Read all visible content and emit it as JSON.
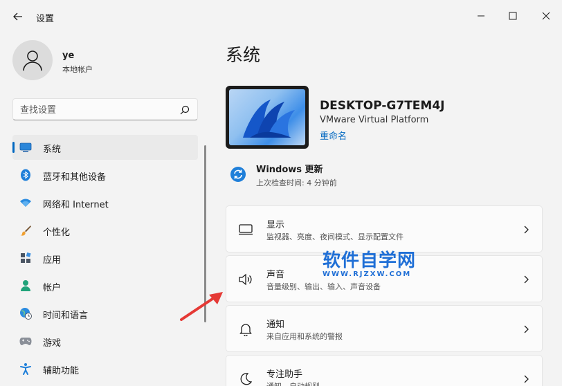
{
  "window": {
    "title": "设置",
    "accent": "#0067c0",
    "annotation_color": "#e53935"
  },
  "user": {
    "name": "ye",
    "account_type": "本地帐户"
  },
  "search": {
    "placeholder": "查找设置"
  },
  "sidebar": {
    "items": [
      {
        "label": "系统",
        "icon": "monitor-icon",
        "active": true
      },
      {
        "label": "蓝牙和其他设备",
        "icon": "bluetooth-icon"
      },
      {
        "label": "网络和 Internet",
        "icon": "wifi-icon"
      },
      {
        "label": "个性化",
        "icon": "brush-icon"
      },
      {
        "label": "应用",
        "icon": "apps-icon"
      },
      {
        "label": "帐户",
        "icon": "person-icon"
      },
      {
        "label": "时间和语言",
        "icon": "globe-clock-icon"
      },
      {
        "label": "游戏",
        "icon": "gamepad-icon"
      },
      {
        "label": "辅助功能",
        "icon": "accessibility-icon"
      }
    ]
  },
  "main": {
    "title": "系统",
    "device": {
      "name": "DESKTOP-G7TEM4J",
      "model": "VMware Virtual Platform",
      "rename_label": "重命名"
    },
    "update": {
      "title": "Windows 更新",
      "subtitle": "上次检查时间: 4 分钟前"
    },
    "cards": [
      {
        "title": "显示",
        "desc": "监视器、亮度、夜间模式、显示配置文件",
        "icon": "display-icon"
      },
      {
        "title": "声音",
        "desc": "音量级别、输出、输入、声音设备",
        "icon": "speaker-icon"
      },
      {
        "title": "通知",
        "desc": "来自应用和系统的警报",
        "icon": "bell-icon"
      },
      {
        "title": "专注助手",
        "desc": "通知、自动规则",
        "icon": "moon-icon"
      }
    ]
  },
  "watermark": {
    "main": "软件自学网",
    "sub": "WWW.RJZXW.COM"
  }
}
